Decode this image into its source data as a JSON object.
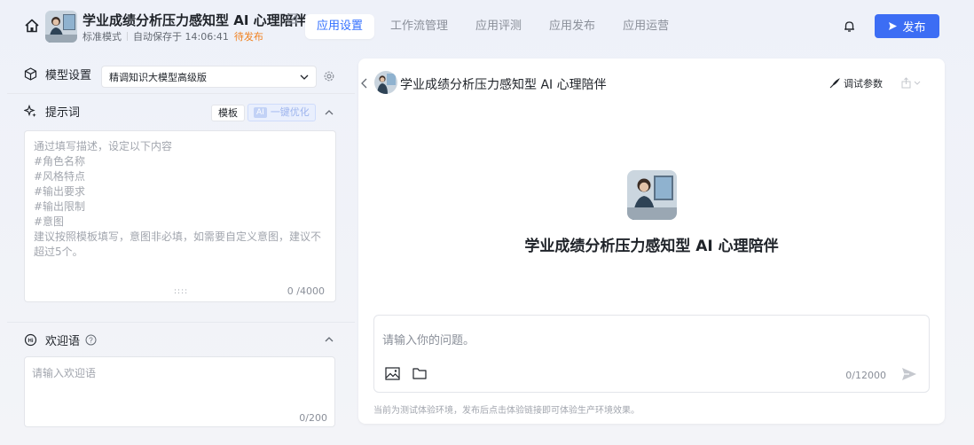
{
  "header": {
    "app_title": "学业成绩分析压力感知型 AI 心理陪伴",
    "mode": "标准模式",
    "autosave": "自动保存于 14:06:41",
    "status": "待发布",
    "publish_label": "发布"
  },
  "nav": {
    "tabs": [
      {
        "label": "应用设置",
        "active": true
      },
      {
        "label": "工作流管理",
        "active": false
      },
      {
        "label": "应用评测",
        "active": false
      },
      {
        "label": "应用发布",
        "active": false
      },
      {
        "label": "应用运营",
        "active": false
      }
    ]
  },
  "model": {
    "label": "模型设置",
    "selected": "精调知识大模型高级版"
  },
  "prompt": {
    "label": "提示词",
    "template_label": "模板",
    "ai_chip": "AI",
    "optimize_label": "一键优化",
    "placeholder": "通过填写描述，设定以下内容\n#角色名称\n#风格特点\n#输出要求\n#输出限制\n#意图\n建议按照模板填写，意图非必填，如需要自定义意图，建议不超过5个。",
    "drag_handle": "::::",
    "count": "0 /4000"
  },
  "welcome": {
    "label": "欢迎语",
    "placeholder": "请输入欢迎语",
    "count": "0/200"
  },
  "preview": {
    "title": "学业成绩分析压力感知型 AI 心理陪伴",
    "debug_label": "调试参数",
    "name": "学业成绩分析压力感知型 AI 心理陪伴",
    "input_placeholder": "请输入你的问题。",
    "input_count": "0/12000",
    "footer": "当前为测试体验环境，发布后点击体验链接即可体验生产环境效果。"
  },
  "colors": {
    "accent": "#3370ff",
    "publish_bg": "#3c6df4",
    "pending": "#f0801e"
  }
}
